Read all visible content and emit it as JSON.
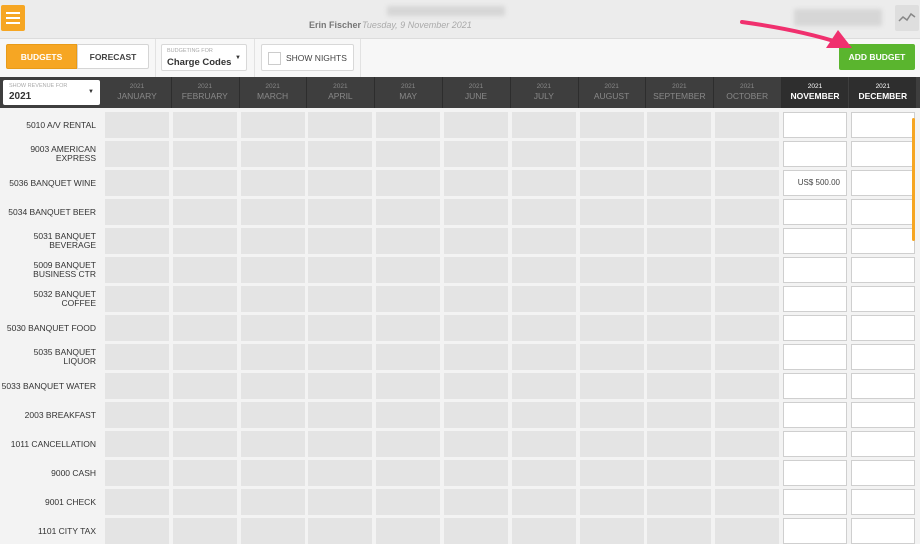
{
  "header": {
    "user_name": "Erin Fischer",
    "date": "Tuesday, 9 November 2021"
  },
  "toolbar": {
    "tab_budgets": "BUDGETS",
    "tab_forecast": "FORECAST",
    "budgeting_for_caption": "BUDGETING FOR",
    "budgeting_for_value": "Charge Codes",
    "show_nights_label": "SHOW NIGHTS",
    "add_budget_label": "ADD BUDGET"
  },
  "revenue_selector": {
    "caption": "SHOW REVENUE FOR",
    "value": "2021"
  },
  "months": [
    {
      "year": "2021",
      "name": "JANUARY"
    },
    {
      "year": "2021",
      "name": "FEBRUARY"
    },
    {
      "year": "2021",
      "name": "MARCH"
    },
    {
      "year": "2021",
      "name": "APRIL"
    },
    {
      "year": "2021",
      "name": "MAY"
    },
    {
      "year": "2021",
      "name": "JUNE"
    },
    {
      "year": "2021",
      "name": "JULY"
    },
    {
      "year": "2021",
      "name": "AUGUST"
    },
    {
      "year": "2021",
      "name": "SEPTEMBER"
    },
    {
      "year": "2021",
      "name": "OCTOBER"
    },
    {
      "year": "2021",
      "name": "NOVEMBER"
    },
    {
      "year": "2021",
      "name": "DECEMBER"
    }
  ],
  "rows": [
    {
      "label": "5010 A/V RENTAL",
      "values": {}
    },
    {
      "label": "9003 AMERICAN EXPRESS",
      "values": {}
    },
    {
      "label": "5036 BANQUET WINE",
      "values": {
        "10": "US$ 500.00"
      }
    },
    {
      "label": "5034 BANQUET BEER",
      "values": {}
    },
    {
      "label": "5031 BANQUET BEVERAGE",
      "values": {}
    },
    {
      "label": "5009 BANQUET BUSINESS CTR",
      "values": {}
    },
    {
      "label": "5032 BANQUET COFFEE",
      "values": {}
    },
    {
      "label": "5030 BANQUET FOOD",
      "values": {}
    },
    {
      "label": "5035 BANQUET LIQUOR",
      "values": {}
    },
    {
      "label": "5033 BANQUET WATER",
      "values": {}
    },
    {
      "label": "2003 BREAKFAST",
      "values": {}
    },
    {
      "label": "1011 CANCELLATION",
      "values": {}
    },
    {
      "label": "9000 CASH",
      "values": {}
    },
    {
      "label": "9001 CHECK",
      "values": {}
    },
    {
      "label": "1101 CITY TAX",
      "values": {}
    }
  ],
  "colors": {
    "accent": "#f6a623",
    "add_button": "#5ab52e",
    "arrow": "#f0306e"
  }
}
